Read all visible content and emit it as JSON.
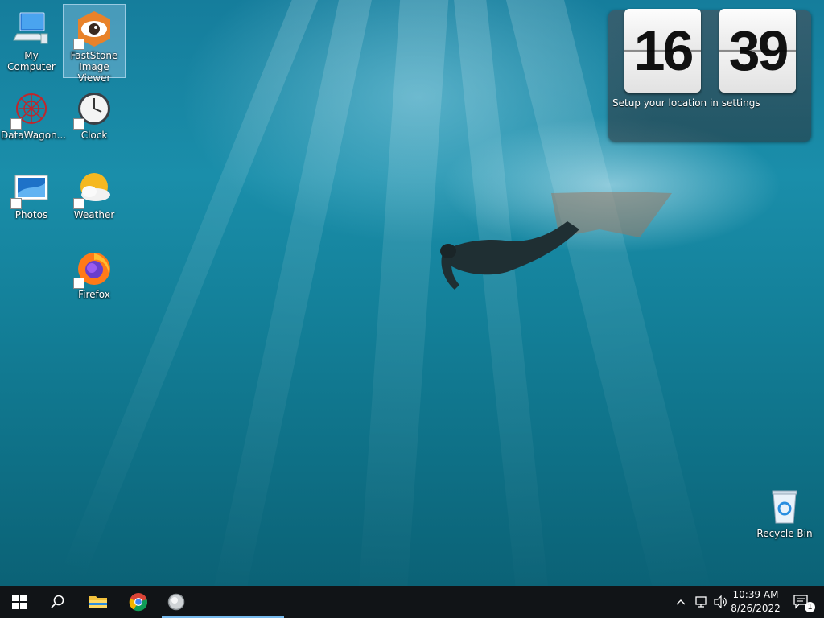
{
  "desktop": {
    "icons": [
      {
        "label": "My Computer"
      },
      {
        "label": "FastStone Image Viewer"
      },
      {
        "label": "DataWagon..."
      },
      {
        "label": "Clock"
      },
      {
        "label": "Photos"
      },
      {
        "label": "Weather"
      },
      {
        "label": "Firefox"
      },
      {
        "label": "Recycle Bin"
      }
    ]
  },
  "clock_gadget": {
    "hours": "16",
    "minutes": "39",
    "message": "Setup your location in settings"
  },
  "taskbar": {
    "pinned": [
      "start-icon",
      "search-icon",
      "file-explorer-icon",
      "chrome-icon",
      "app-icon"
    ],
    "tray": {
      "time": "10:39 AM",
      "date": "8/26/2022",
      "notification_count": "1"
    }
  },
  "colors": {
    "taskbar": "#111417",
    "accent": "#76b9ed",
    "water": "#157d9c"
  }
}
